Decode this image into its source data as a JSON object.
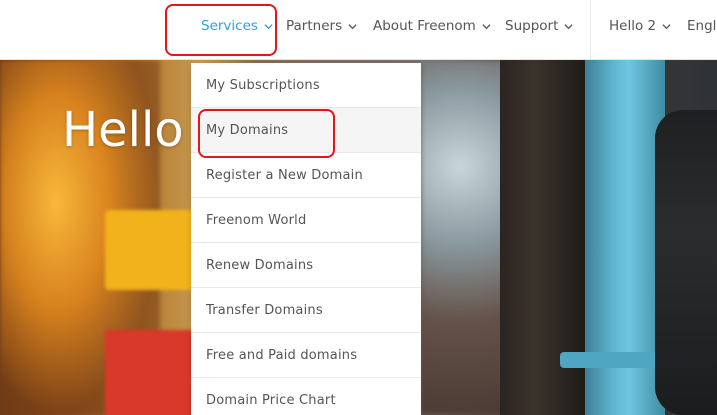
{
  "nav": {
    "items": [
      {
        "label": "Services"
      },
      {
        "label": "Partners"
      },
      {
        "label": "About Freenom"
      },
      {
        "label": "Support"
      }
    ],
    "user_label": "Hello 2",
    "language_label": "Engli",
    "active_color": "#2aa3d8"
  },
  "hero": {
    "title": "Hello"
  },
  "dropdown": {
    "items": [
      {
        "label": "My Subscriptions"
      },
      {
        "label": "My Domains"
      },
      {
        "label": "Register a New Domain"
      },
      {
        "label": "Freenom World"
      },
      {
        "label": "Renew Domains"
      },
      {
        "label": "Transfer Domains"
      },
      {
        "label": "Free and Paid domains"
      },
      {
        "label": "Domain Price Chart"
      }
    ]
  },
  "annotation_color": "#e3161b"
}
